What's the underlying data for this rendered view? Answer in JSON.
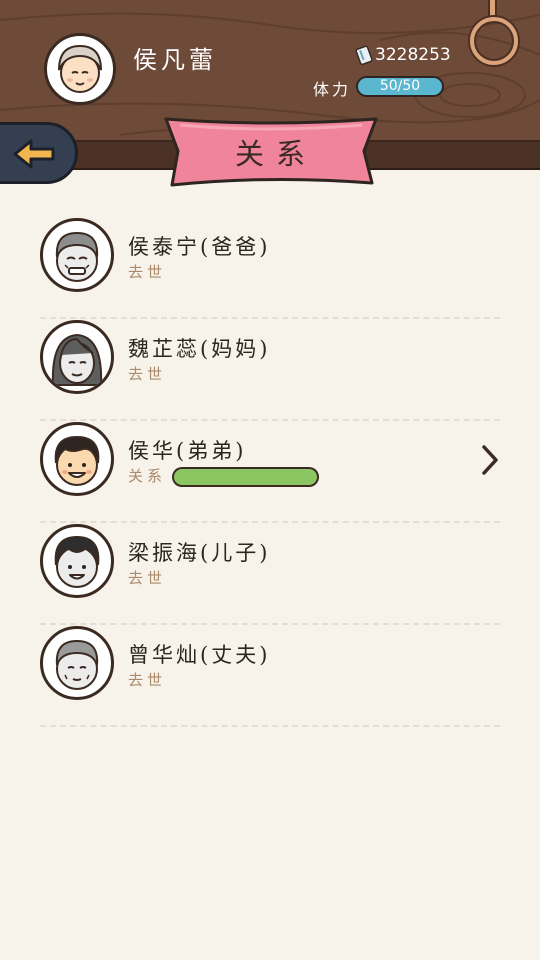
{
  "header": {
    "player_name": "侯凡蕾",
    "money": "3228253",
    "stamina_label": "体力",
    "stamina_value": "50/50"
  },
  "page_title": "关系",
  "relations": [
    {
      "name": "侯泰宁(爸爸)",
      "status": "去世",
      "face": "old-man-grey"
    },
    {
      "name": "魏芷蕊(妈妈)",
      "status": "去世",
      "face": "woman-grey"
    },
    {
      "name": "侯华(弟弟)",
      "status": "关系",
      "face": "young-man-color",
      "relationship_level": 1.0
    },
    {
      "name": "梁振海(儿子)",
      "status": "去世",
      "face": "man-grey"
    },
    {
      "name": "曾华灿(丈夫)",
      "status": "去世",
      "face": "old-man-grey"
    }
  ],
  "colors": {
    "ribbon": "#f0849a",
    "stamina_bar": "#5bb7d0",
    "relation_bar": "#8cc663",
    "wood": "#6e4a38",
    "back_button": "#344052",
    "back_arrow": "#f2b650"
  },
  "icons": [
    "money-note-icon",
    "back-arrow-icon",
    "hanging-ring-icon",
    "chevron-right-icon"
  ]
}
